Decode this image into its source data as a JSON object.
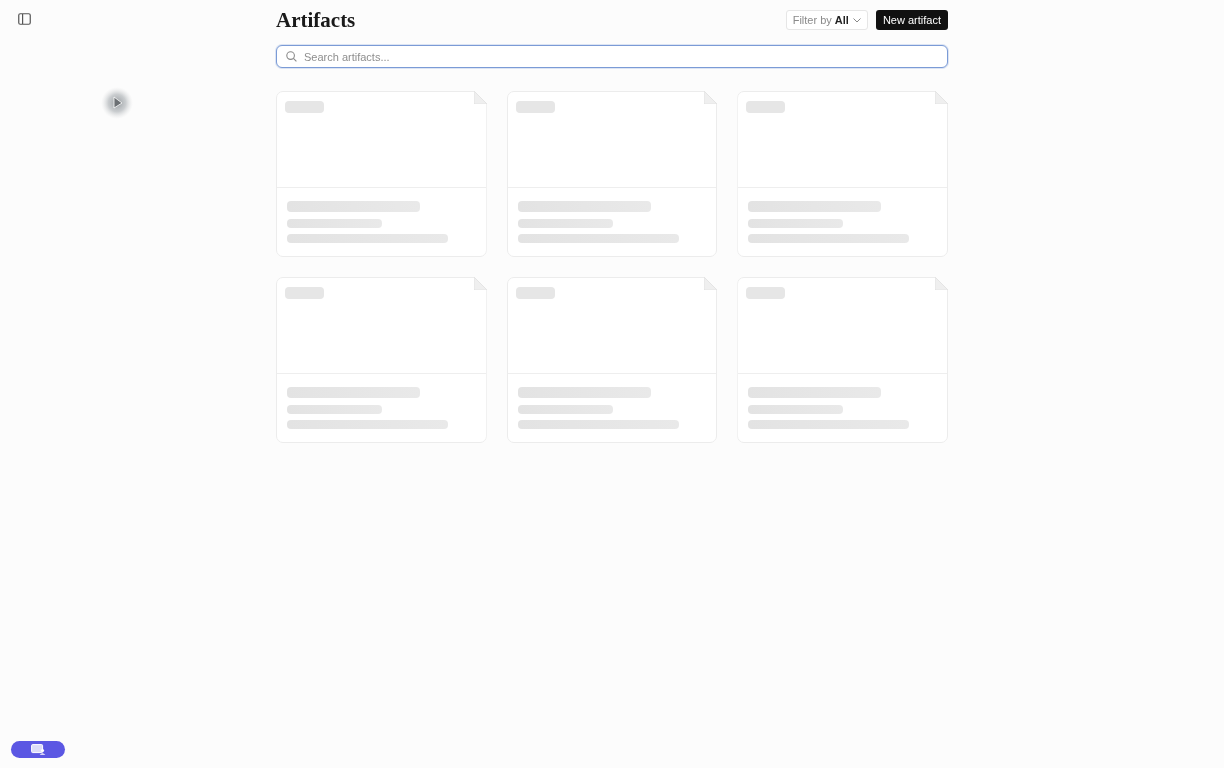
{
  "header": {
    "title": "Artifacts",
    "filter_button": "Filter by **All**",
    "new_button": "New artifact"
  },
  "search": {
    "placeholder": "Search artifacts...",
    "focused": true
  },
  "artifact_cards": [
    {
      "kind": "skeleton"
    },
    {
      "kind": "skeleton"
    },
    {
      "kind": "skeleton"
    },
    {
      "kind": "skeleton"
    },
    {
      "kind": "skeleton"
    },
    {
      "kind": "skeleton"
    }
  ]
}
